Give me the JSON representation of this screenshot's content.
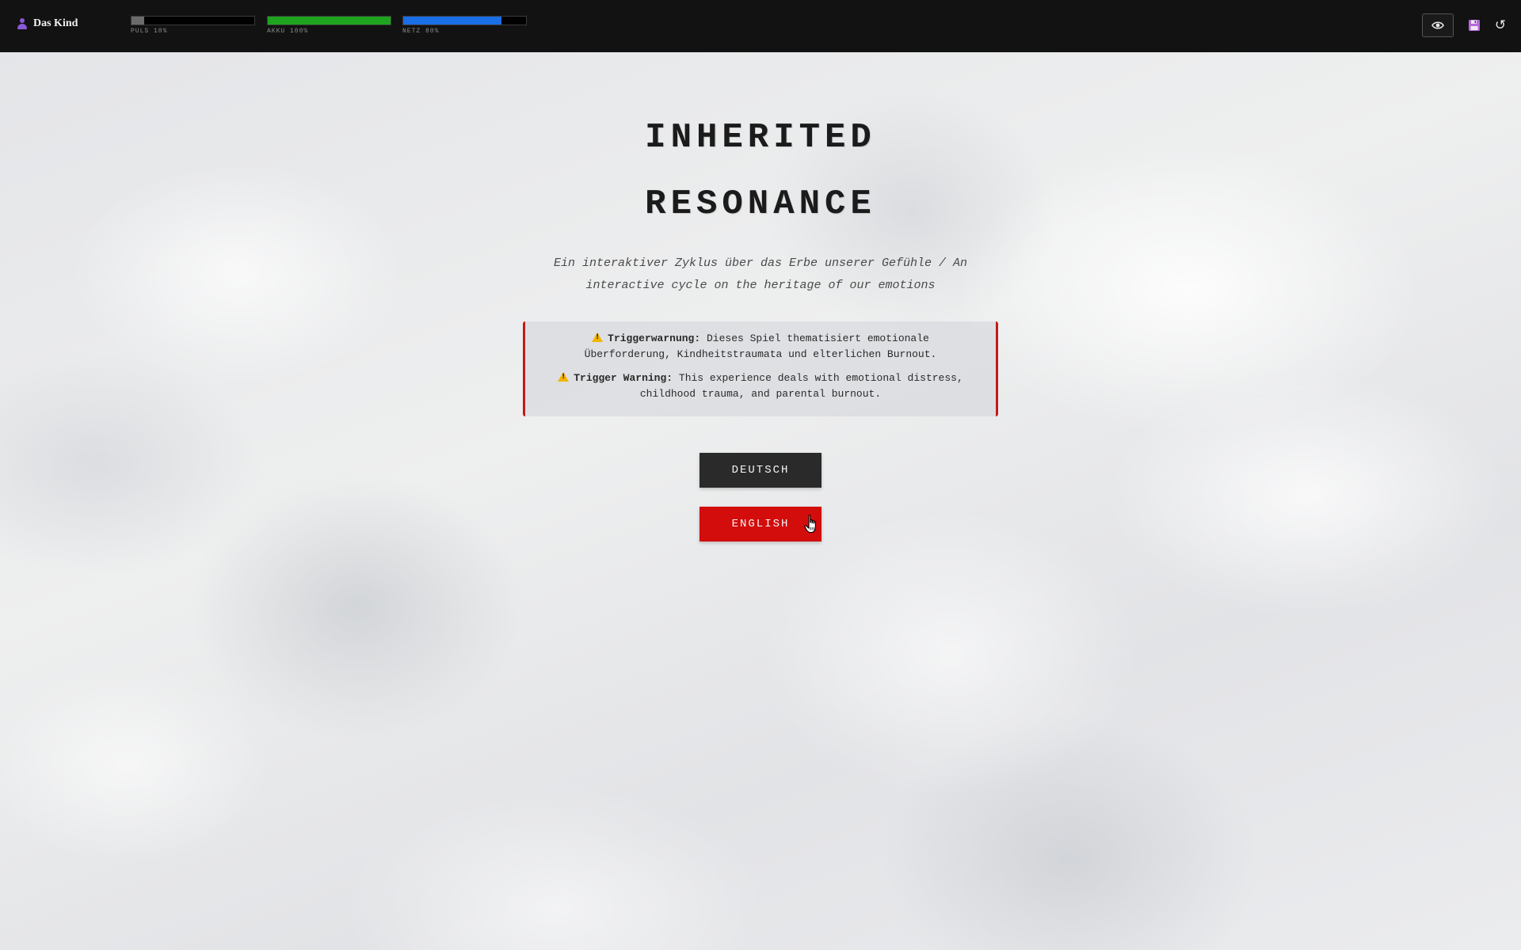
{
  "topbar": {
    "character": {
      "icon": "person-icon",
      "name": "Das Kind",
      "icon_color": "#8a5ad6"
    },
    "stats": [
      {
        "id": "puls",
        "label": "PULS 10%",
        "value": 0.1,
        "color": "#6b6b6b"
      },
      {
        "id": "akku",
        "label": "AKKU 100%",
        "value": 1.0,
        "color": "#1fa31f"
      },
      {
        "id": "netz",
        "label": "NETZ 80%",
        "value": 0.8,
        "color": "#1a6ee6"
      }
    ],
    "actions": {
      "eye_icon": "eye-icon",
      "save_icon": "floppy-disk-icon",
      "reset_icon": "reset-icon",
      "reset_glyph": "↺"
    }
  },
  "main": {
    "title_line1": "INHERITED",
    "title_line2": "RESONANCE",
    "subtitle": "Ein interaktiver Zyklus über das Erbe unserer Gefühle / An interactive cycle on the heritage of our emotions",
    "warnings": [
      {
        "label": "Triggerwarnung:",
        "text": "Dieses Spiel thematisiert emotionale Überforderung, Kindheitstraumata und elterlichen Burnout."
      },
      {
        "label": "Trigger Warning:",
        "text": "This experience deals with emotional distress, childhood trauma, and parental burnout."
      }
    ],
    "buttons": {
      "deutsch": "DEUTSCH",
      "english": "ENGLISH"
    }
  },
  "colors": {
    "topbar_bg": "#121212",
    "accent_red": "#d30c0c",
    "button_dark": "#2a2a2a",
    "warning_border": "#c41a1a"
  }
}
